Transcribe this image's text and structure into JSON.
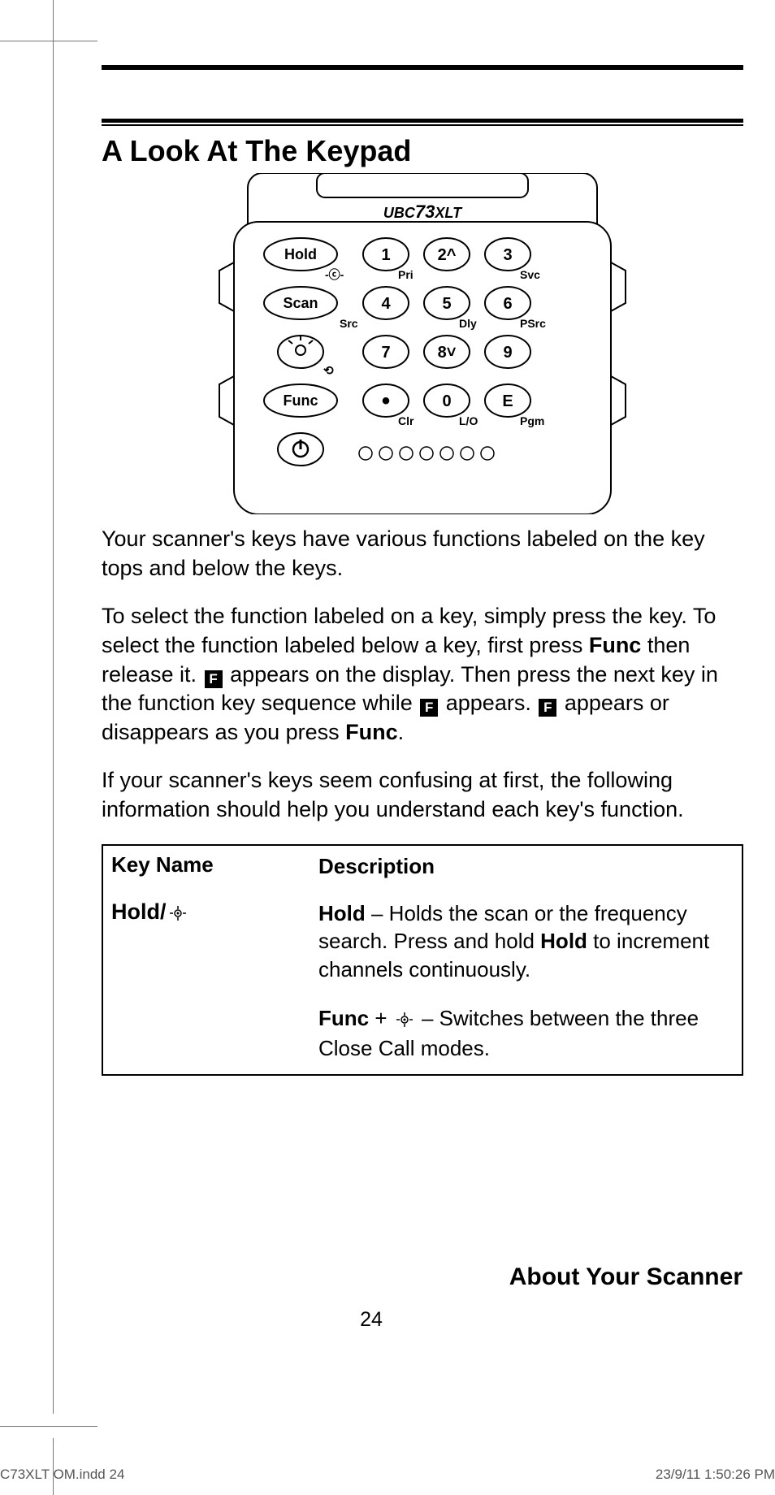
{
  "section_title": "A Look At The Keypad",
  "device_model": "UBC73XLT",
  "keypad": {
    "left_column": [
      "Hold",
      "Scan",
      "",
      "Func",
      ""
    ],
    "left_icons": [
      "",
      "",
      "light",
      "",
      "power"
    ],
    "digits_row1": [
      "1",
      "2^",
      "3"
    ],
    "digits_row2": [
      "4",
      "5",
      "6"
    ],
    "digits_row3": [
      "7",
      "8˅",
      "9"
    ],
    "digits_row4": [
      "•",
      "0",
      "E"
    ],
    "sub_labels_row1": [
      "Pri",
      "",
      "Svc"
    ],
    "sub_labels_row2": [
      "Src",
      "Dly",
      "PSrc"
    ],
    "sub_labels_row3": [
      "",
      "",
      ""
    ],
    "sub_labels_row4": [
      "Clr",
      "L/O",
      "Pgm"
    ],
    "left_sub_labels": [
      "-ⓒ-",
      "",
      "⟲",
      "",
      ""
    ]
  },
  "para1": "Your scanner's keys have various functions labeled on the key tops and below the keys.",
  "para2_a": "To select the function labeled on a key, simply press the key. To select the function labeled below a key, first press ",
  "para2_func": "Func",
  "para2_b": " then release it. ",
  "para2_c": " appears on the display. Then press the next key in the function key sequence while ",
  "para2_d": " appears. ",
  "para2_e": " appears or disappears as you press ",
  "para2_func2": "Func",
  "para2_f": ".",
  "para3": "If your scanner's keys seem confusing at first, the following information should help you understand each key's function.",
  "table": {
    "header_col1": "Key Name",
    "header_col2": "Description",
    "row1_key": "Hold/",
    "row1_desc1_bold1": "Hold",
    "row1_desc1_a": " – Holds the scan or the frequency search. Press and hold ",
    "row1_desc1_bold2": "Hold",
    "row1_desc1_b": " to increment channels continuously.",
    "row1_desc2_bold": "Func",
    "row1_desc2_a": " + ",
    "row1_desc2_b": " – Switches between the three Close Call modes."
  },
  "footer_title": "About Your Scanner",
  "page_number": "24",
  "indd_left": "C73XLT OM.indd   24",
  "indd_right": "23/9/11   1:50:26 PM",
  "icons": {
    "f_glyph": "F"
  }
}
